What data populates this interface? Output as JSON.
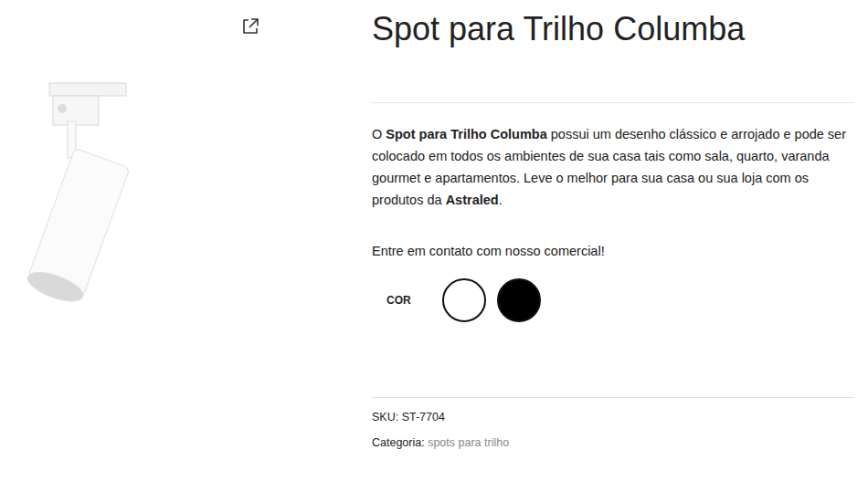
{
  "product": {
    "title": "Spot para Trilho Columba",
    "description": [
      {
        "text": "O ",
        "bold": false
      },
      {
        "text": "Spot para Trilho Columba",
        "bold": true
      },
      {
        "text": " possui um desenho clássico e arrojado e pode ser colocado em todos os ambientes de sua casa tais como sala, quarto, varanda gourmet e apartamentos. Leve o melhor para sua casa ou sua loja com os produtos da ",
        "bold": false
      },
      {
        "text": "Astraled",
        "bold": true
      },
      {
        "text": ".",
        "bold": false
      }
    ],
    "contact": "Entre em contato com nosso comercial!",
    "color_label": "COR",
    "colors": [
      {
        "name": "branco",
        "color": "#ffffff"
      },
      {
        "name": "preto",
        "color": "#000000"
      }
    ],
    "meta": {
      "sku_label": "SKU:",
      "sku": "ST-7704",
      "category_label": "Categoria:",
      "category": "spots para trilho"
    }
  }
}
